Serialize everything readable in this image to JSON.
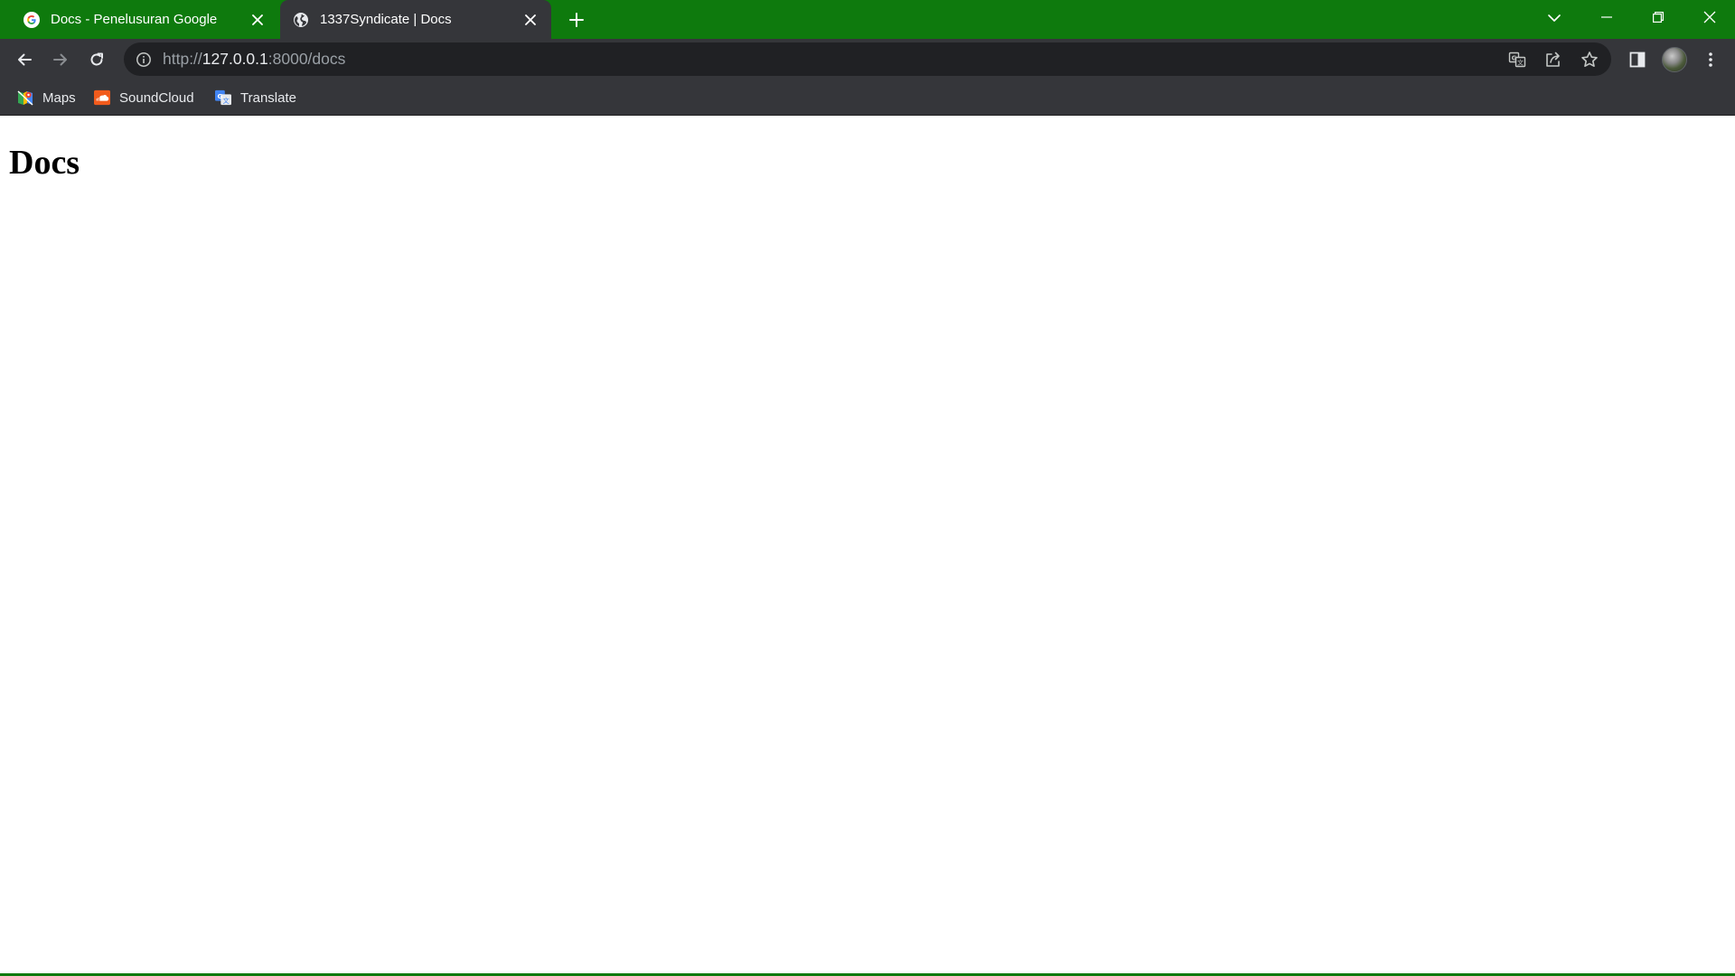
{
  "tabs": [
    {
      "title": "Docs - Penelusuran Google",
      "favicon": "google-icon",
      "active": false
    },
    {
      "title": "1337Syndicate | Docs",
      "favicon": "globe-icon",
      "active": true
    }
  ],
  "address_bar": {
    "scheme": "http://",
    "host": "127.0.0.1",
    "path": ":8000/docs"
  },
  "bookmarks": [
    {
      "label": "Maps",
      "icon": "maps-icon"
    },
    {
      "label": "SoundCloud",
      "icon": "soundcloud-icon"
    },
    {
      "label": "Translate",
      "icon": "translate-icon"
    }
  ],
  "page": {
    "heading": "Docs"
  },
  "colors": {
    "frame": "#0e7a0d",
    "toolbar": "#35363a",
    "omnibox": "#202124"
  }
}
